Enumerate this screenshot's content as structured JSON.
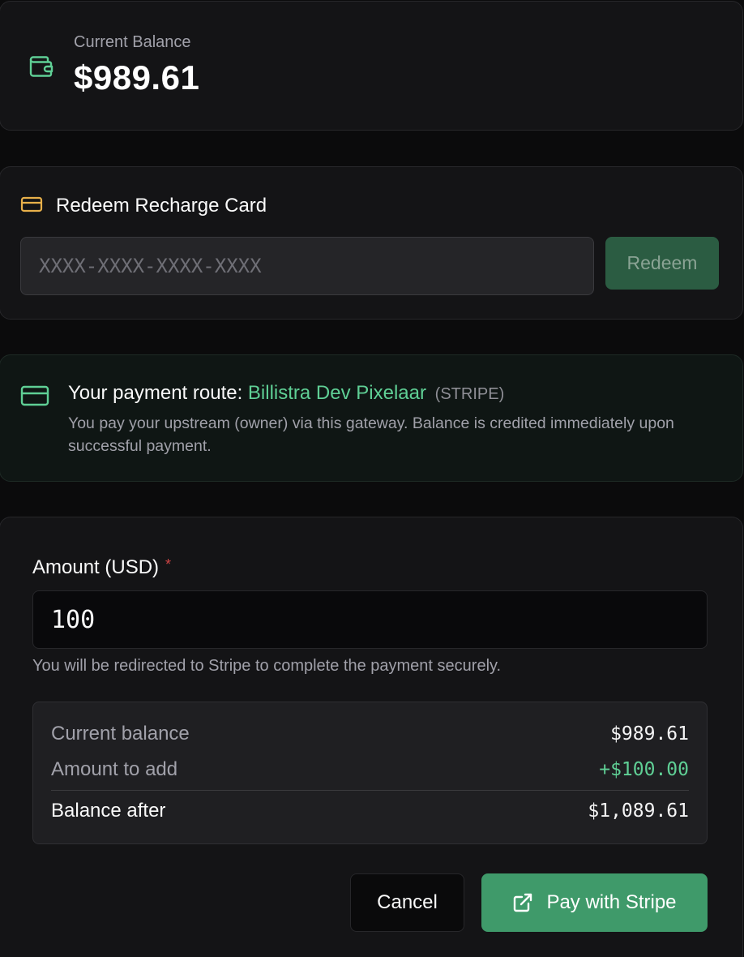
{
  "balance": {
    "label": "Current Balance",
    "value": "$989.61",
    "icon": "wallet-icon"
  },
  "redeem": {
    "title": "Redeem Recharge Card",
    "icon": "credit-card-icon",
    "input_placeholder": "XXXX-XXXX-XXXX-XXXX",
    "input_value": "",
    "button_label": "Redeem"
  },
  "route": {
    "icon": "credit-card-icon",
    "title_prefix": "Your payment route:",
    "gateway_name": "Billistra Dev Pixelaar",
    "gateway_type": "(STRIPE)",
    "description": "You pay your upstream (owner) via this gateway. Balance is credited immediately upon successful payment."
  },
  "payment": {
    "amount_label": "Amount (USD)",
    "required_mark": "*",
    "amount_value": "100",
    "help_text": "You will be redirected to Stripe to complete the payment securely.",
    "summary": {
      "current_label": "Current balance",
      "current_value": "$989.61",
      "add_label": "Amount to add",
      "add_value": "+$100.00",
      "after_label": "Balance after",
      "after_value": "$1,089.61"
    },
    "cancel_label": "Cancel",
    "pay_label": "Pay with Stripe",
    "pay_icon": "external-link-icon"
  },
  "colors": {
    "accent_green": "#5fcf95",
    "button_green": "#3f9a6a",
    "card_icon_yellow": "#e8b04a",
    "required_red": "#d04545"
  }
}
